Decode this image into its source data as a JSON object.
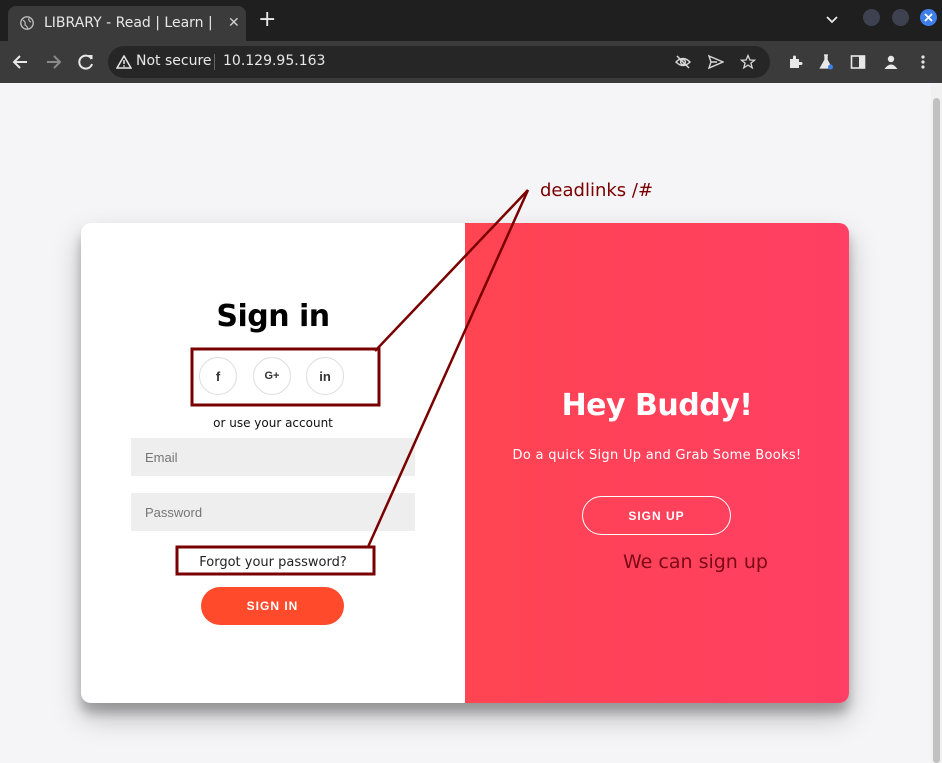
{
  "browser": {
    "tab_title": "LIBRARY - Read | Learn | H",
    "new_tab_label": "+",
    "not_secure_label": "Not secure",
    "url": "10.129.95.163",
    "close_tab_label": "✕"
  },
  "signin": {
    "title": "Sign in",
    "social": [
      {
        "label": "f",
        "icon": "facebook-icon"
      },
      {
        "label": "G+",
        "icon": "google-plus-icon"
      },
      {
        "label": "in",
        "icon": "linkedin-icon"
      }
    ],
    "use_account_text": "or use your account",
    "email_placeholder": "Email",
    "password_placeholder": "Password",
    "forgot_link": "Forgot your password?",
    "signin_button": "SIGN IN"
  },
  "overlay": {
    "title": "Hey Buddy!",
    "subtitle": "Do a quick Sign Up and Grab Some Books!",
    "signup_button": "SIGN UP"
  },
  "annotations": {
    "deadlinks": "deadlinks /#",
    "signup_note": "We can sign up"
  },
  "colors": {
    "signin_button": "#ff4b2b",
    "overlay_gradient_start": "#ff4452",
    "overlay_gradient_end": "#ff3f63",
    "annotation": "#7a0000"
  }
}
